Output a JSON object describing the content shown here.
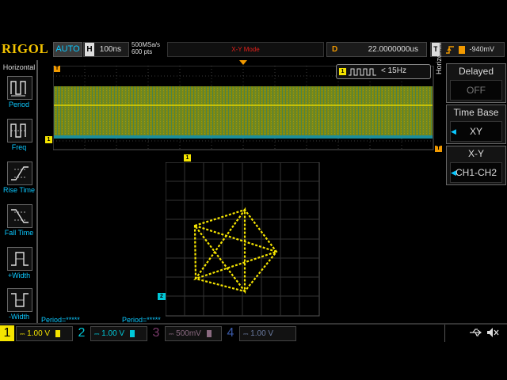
{
  "brand": "RIGOL",
  "trigger_mode": "AUTO",
  "horizontal": {
    "prefix": "H",
    "timebase": "100ns"
  },
  "sample_rate": "500MSa/s",
  "memory_depth": "600 pts",
  "display_mode": "X-Y Mode",
  "delay": {
    "prefix": "D",
    "value": "22.0000000us"
  },
  "trigger": {
    "prefix": "T",
    "level": "-940mV"
  },
  "left_menu": {
    "title": "Horizontal",
    "items": [
      {
        "label": "Period"
      },
      {
        "label": "Freq"
      },
      {
        "label": "Rise Time"
      },
      {
        "label": "Fall Time"
      },
      {
        "label": "+Width"
      },
      {
        "label": "-Width"
      }
    ]
  },
  "right_menu": {
    "side_tab": "Horizontal",
    "delayed": {
      "title": "Delayed",
      "value": "OFF"
    },
    "time_base": {
      "title": "Time Base",
      "value": "XY"
    },
    "xy": {
      "title": "X-Y",
      "value": "CH1-CH2"
    }
  },
  "frequency_readout": "< 15Hz",
  "measurements": [
    {
      "label": "Period=*****",
      "color": "#0bc8ff"
    },
    {
      "label": "Period=*****",
      "color": "#0bc8ff"
    }
  ],
  "channels": [
    {
      "num": "1",
      "scale": "1.00 V",
      "color": "#f5e400",
      "active": true
    },
    {
      "num": "2",
      "scale": "1.00 V",
      "color": "#00c8d8",
      "active": true
    },
    {
      "num": "3",
      "scale": "500mV",
      "color": "#c03aa0",
      "active": false
    },
    {
      "num": "4",
      "scale": "1.00 V",
      "color": "#3a6ad8",
      "active": false
    }
  ],
  "colors": {
    "ch1": "#f5e400",
    "ch2": "#00c8d8",
    "accent": "#0bc8ff",
    "trigger": "#f29a00",
    "mode_text": "#e0201a"
  },
  "status_icons": [
    "usb-icon",
    "speaker-muted-icon"
  ]
}
